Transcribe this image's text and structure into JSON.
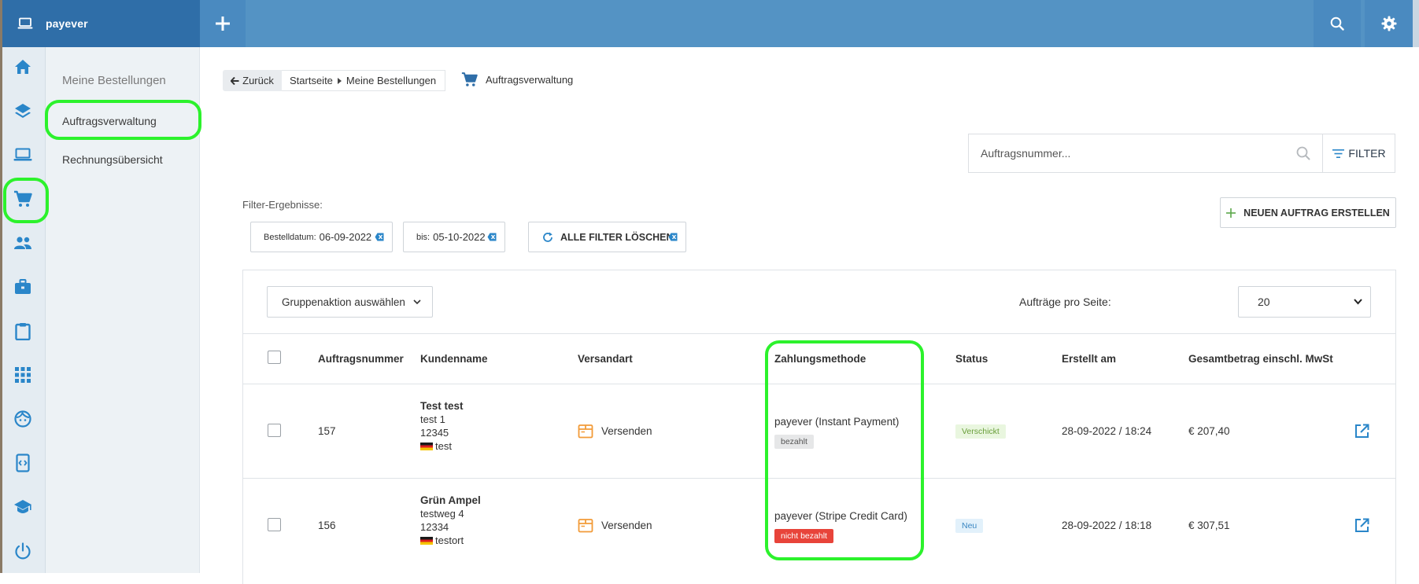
{
  "app": {
    "name": "payever"
  },
  "colors": {
    "topbar": "#5493c4",
    "brand": "#2f6ea8",
    "accent": "#2a86c9",
    "highlight": "#2cf22c",
    "orange": "#f29b38"
  },
  "topbar": {
    "icons": [
      "laptop-icon",
      "plus-icon",
      "search-icon",
      "gear-icon"
    ]
  },
  "rail": {
    "icons": [
      "home-icon",
      "layers-icon",
      "laptop-icon",
      "cart-icon",
      "people-icon",
      "briefcase-icon",
      "clipboard-icon",
      "apps-grid-icon",
      "face-icon",
      "code-phone-icon",
      "graduation-cap-icon",
      "power-icon"
    ]
  },
  "subnav": {
    "title": "Meine Bestellungen",
    "items": [
      {
        "label": "Auftragsverwaltung"
      },
      {
        "label": "Rechnungsübersicht"
      }
    ]
  },
  "header": {
    "back_label": "Zurück",
    "breadcrumb": [
      "Startseite",
      "Meine Bestellungen"
    ],
    "page_title": "Auftragsverwaltung"
  },
  "search": {
    "placeholder": "Auftragsnummer...",
    "filter_label": "FILTER"
  },
  "filters": {
    "label": "Filter-Ergebnisse:",
    "chips": [
      {
        "key": "Bestelldatum:",
        "value": "06-09-2022"
      },
      {
        "key": "bis:",
        "value": "05-10-2022"
      }
    ],
    "clear_label": "ALLE FILTER LÖSCHEN"
  },
  "new_order_label": "NEUEN AUFTRAG ERSTELLEN",
  "table": {
    "group_action": "Gruppenaktion auswählen",
    "per_page_label": "Aufträge pro Seite:",
    "per_page_value": "20",
    "columns": [
      "Auftragsnummer",
      "Kundenname",
      "Versandart",
      "Zahlungsmethode",
      "Status",
      "Erstellt am",
      "Gesamtbetrag einschl. MwSt"
    ],
    "rows": [
      {
        "number": "157",
        "customer": {
          "name": "Test test",
          "street": "test 1",
          "zip": "12345",
          "city": "test"
        },
        "shipping": "Versenden",
        "payment": "payever (Instant Payment)",
        "payment_status": "bezahlt",
        "status": "Verschickt",
        "created": "28-09-2022 / 18:24",
        "total": "€ 207,40"
      },
      {
        "number": "156",
        "customer": {
          "name": "Grün Ampel",
          "street": "testweg 4",
          "zip": "12334",
          "city": "testort"
        },
        "shipping": "Versenden",
        "payment": "payever (Stripe Credit Card)",
        "payment_status": "nicht bezahlt",
        "status": "Neu",
        "created": "28-09-2022 / 18:18",
        "total": "€ 307,51"
      }
    ]
  }
}
